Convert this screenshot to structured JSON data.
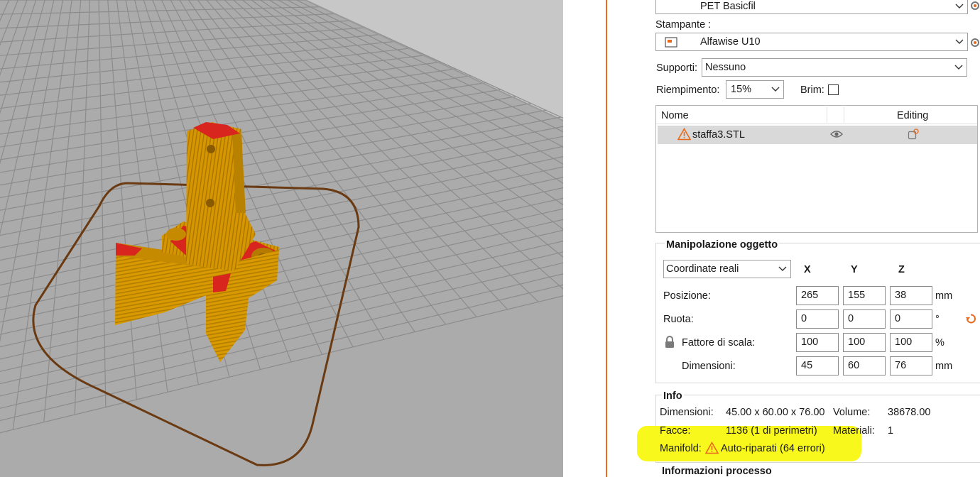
{
  "filament": {
    "value": "PET Basicfil"
  },
  "printer": {
    "label": "Stampante :",
    "value": "Alfawise U10"
  },
  "supports": {
    "label": "Supporti:",
    "value": "Nessuno"
  },
  "infill": {
    "label": "Riempimento:",
    "value": "15%"
  },
  "brim": {
    "label": "Brim:",
    "checked": false
  },
  "object_list": {
    "col_name": "Nome",
    "col_editing": "Editing",
    "rows": [
      {
        "name": "staffa3.STL",
        "warning": true
      }
    ]
  },
  "manipulation": {
    "title": "Manipolazione oggetto",
    "coords": "Coordinate reali",
    "axes": [
      "X",
      "Y",
      "Z"
    ],
    "position": {
      "label": "Posizione:",
      "values": [
        "265",
        "155",
        "38"
      ],
      "unit": "mm"
    },
    "rotation": {
      "label": "Ruota:",
      "values": [
        "0",
        "0",
        "0"
      ],
      "unit": "°"
    },
    "scale": {
      "label": "Fattore di scala:",
      "values": [
        "100",
        "100",
        "100"
      ],
      "unit": "%"
    },
    "size": {
      "label": "Dimensioni:",
      "values": [
        "45",
        "60",
        "76"
      ],
      "unit": "mm"
    }
  },
  "info": {
    "title": "Info",
    "dimensions_label": "Dimensioni:",
    "dimensions_value": "45.00 x 60.00 x 76.00",
    "volume_label": "Volume:",
    "volume_value": "38678.00",
    "facets_label": "Facce:",
    "facets_value": "1136 (1 di perimetri)",
    "materials_label": "Materiali:",
    "materials_value": "1",
    "manifold_label": "Manifold:",
    "manifold_value": "Auto-riparati (64 errori)"
  },
  "process": {
    "title": "Informazioni processo"
  },
  "colors": {
    "accent": "#ed6b21",
    "warning": "#e86a1e",
    "highlight": "#f8f81c",
    "model": "#d99a00",
    "model_top": "#d8261e",
    "bed": "#ababab",
    "bed_grid": "#8c8c8c"
  }
}
